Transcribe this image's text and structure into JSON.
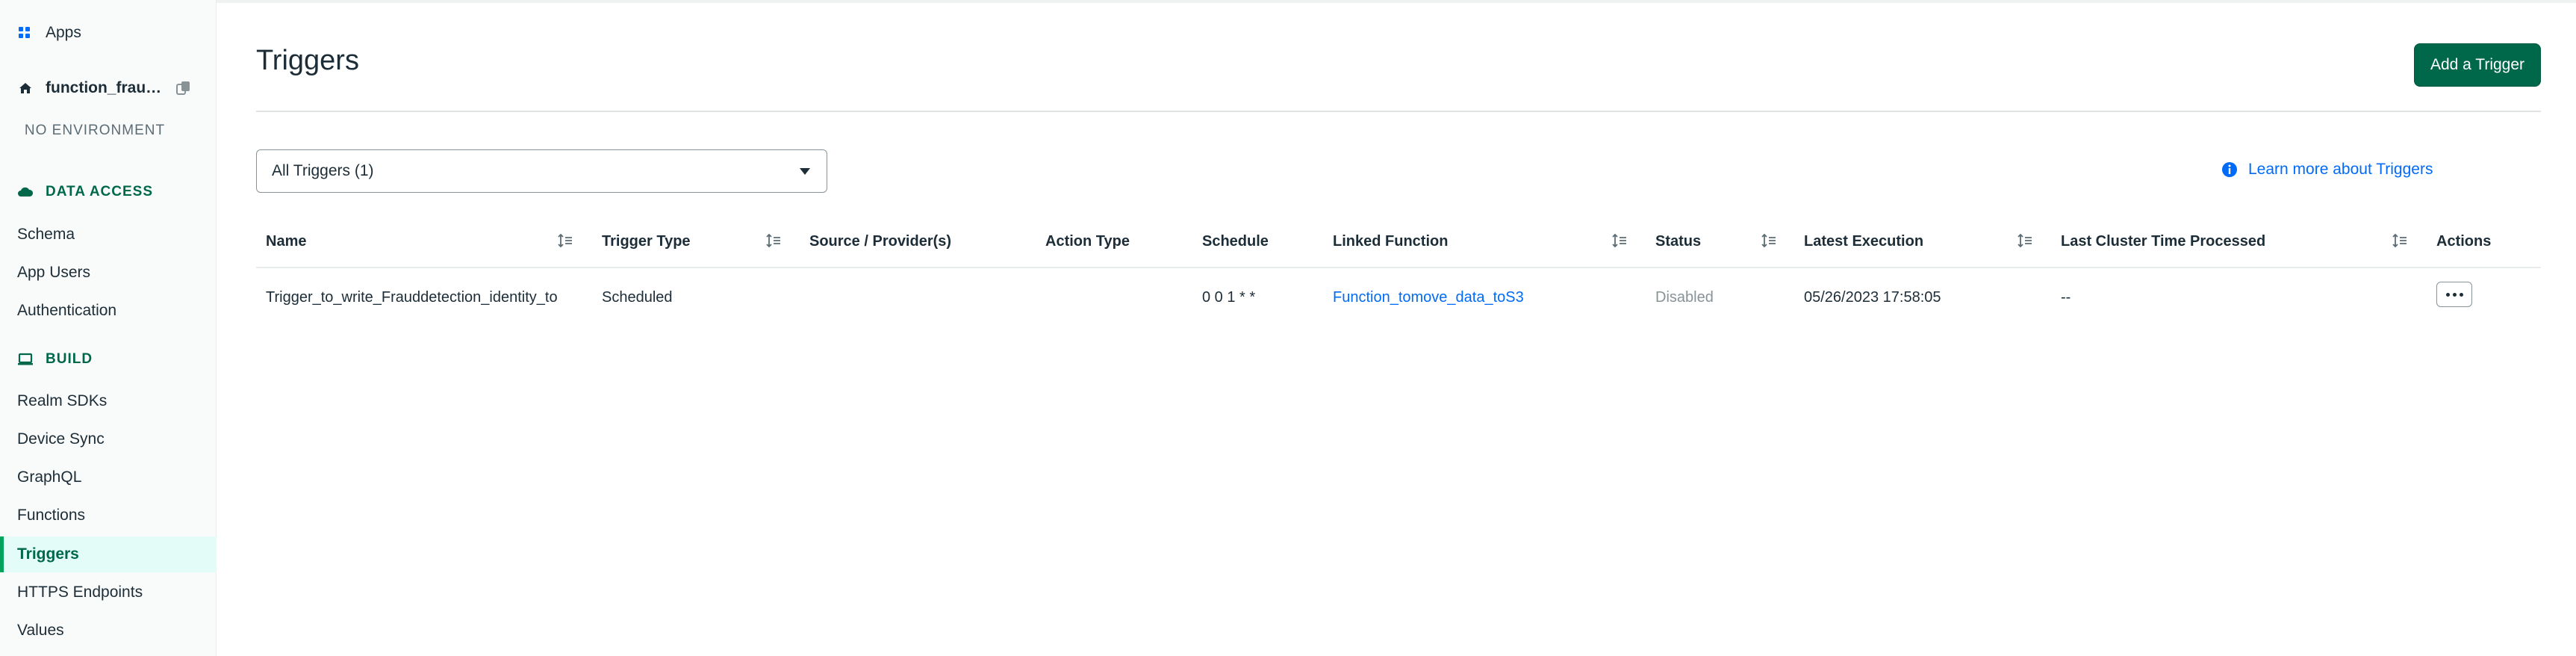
{
  "sidebar": {
    "apps_label": "Apps",
    "app_name": "function_frau…",
    "environment": "NO ENVIRONMENT",
    "data_access": {
      "title": "DATA ACCESS",
      "items": [
        {
          "label": "Schema"
        },
        {
          "label": "App Users"
        },
        {
          "label": "Authentication"
        }
      ]
    },
    "build": {
      "title": "BUILD",
      "items": [
        {
          "label": "Realm SDKs"
        },
        {
          "label": "Device Sync"
        },
        {
          "label": "GraphQL"
        },
        {
          "label": "Functions"
        },
        {
          "label": "Triggers",
          "active": true
        },
        {
          "label": "HTTPS Endpoints"
        },
        {
          "label": "Values"
        }
      ]
    }
  },
  "header": {
    "title": "Triggers",
    "add_button": "Add a Trigger"
  },
  "filter": {
    "selected": "All Triggers (1)"
  },
  "learn_more": "Learn more about Triggers",
  "table": {
    "columns": [
      "Name",
      "Trigger Type",
      "Source / Provider(s)",
      "Action Type",
      "Schedule",
      "Linked Function",
      "Status",
      "Latest Execution",
      "Last Cluster Time Processed",
      "Actions"
    ],
    "rows": [
      {
        "name": "Trigger_to_write_Frauddetection_identity_to",
        "trigger_type": "Scheduled",
        "source": "",
        "action_type": "",
        "schedule": "0 0 1 * *",
        "linked_function": "Function_tomove_data_toS3",
        "status": "Disabled",
        "latest_execution": "05/26/2023 17:58:05",
        "last_cluster_time": "--"
      }
    ]
  },
  "colors": {
    "accent": "#00684a",
    "link": "#016bf8",
    "active_bg": "#e3fcf7"
  }
}
